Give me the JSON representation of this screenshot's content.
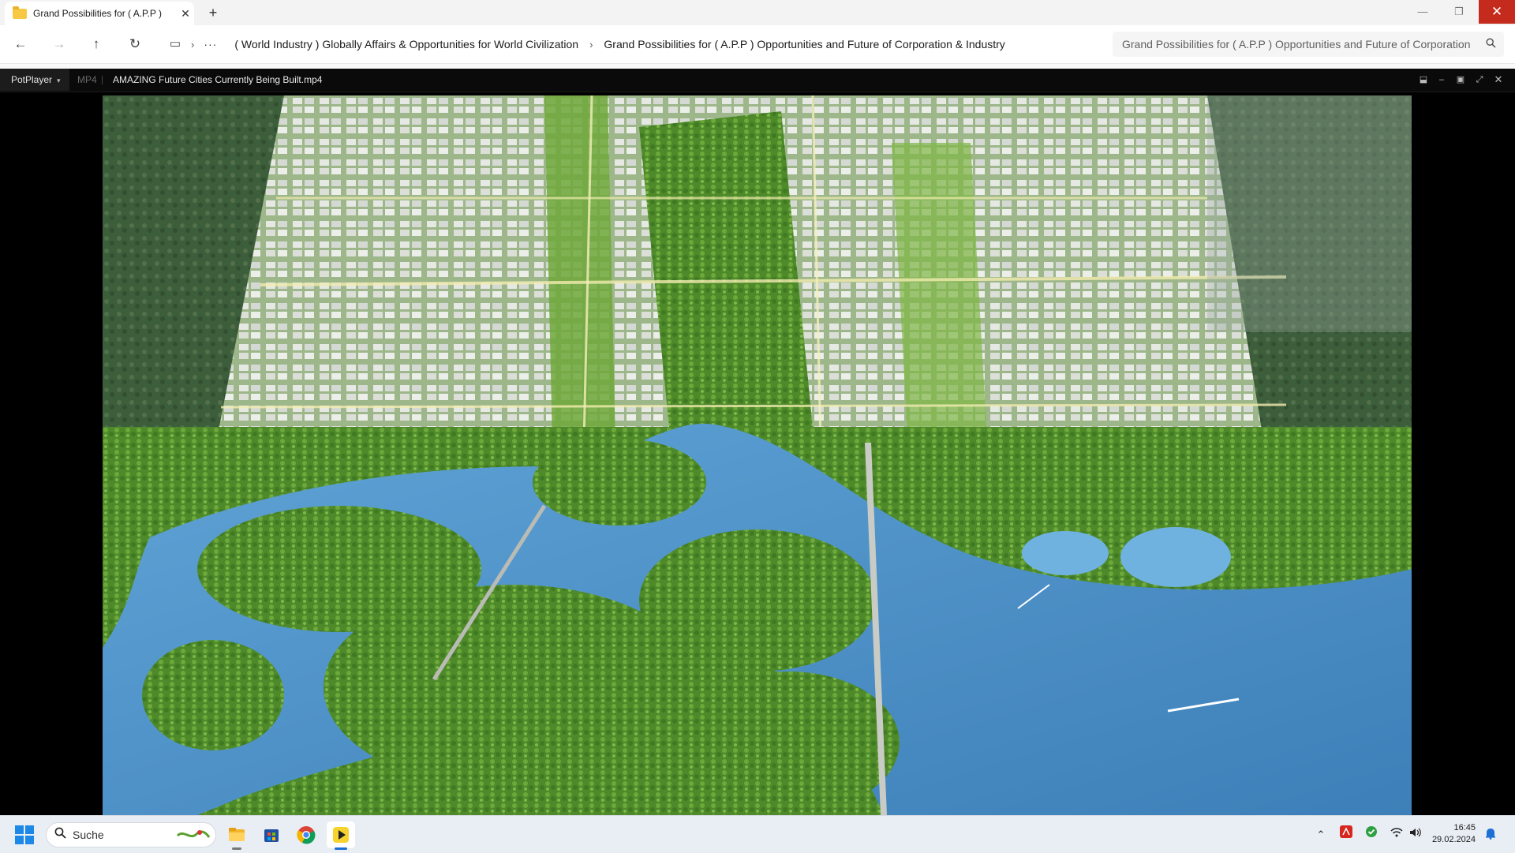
{
  "explorer": {
    "tab_title": "Grand Possibilities for ( A.P.P )",
    "breadcrumb": [
      "( World Industry ) Globally Affairs & Opportunities for World Civilization",
      "Grand Possibilities for ( A.P.P ) Opportunities and Future of Corporation & Industry"
    ],
    "search_placeholder": "Grand Possibilities for ( A.P.P ) Opportunities and Future of Corporation",
    "icons": [
      "folder-icon",
      "close-icon",
      "plus-icon",
      "back-icon",
      "forward-icon",
      "up-icon",
      "refresh-icon",
      "monitor-icon",
      "chevron-right-icon",
      "more-icon",
      "search-icon",
      "minimize-icon",
      "restore-icon"
    ]
  },
  "player": {
    "app_name": "PotPlayer",
    "format": "MP4",
    "filename": "AMAZING Future Cities Currently Being Built.mp4",
    "controls": [
      "pin-icon",
      "minimize-icon",
      "maximize-icon",
      "fullscreen-icon",
      "close-icon"
    ]
  },
  "taskbar": {
    "search_label": "Suche",
    "apps": [
      "file-explorer-icon",
      "microsoft-store-icon",
      "chrome-icon",
      "potplayer-icon"
    ],
    "active_app": "potplayer-icon",
    "tray": [
      "chevron-up-icon",
      "acrobat-icon",
      "security-check-icon",
      "wifi-icon",
      "volume-icon",
      "notification-bell-icon"
    ],
    "time": "16:45",
    "date": "29.02.2024"
  },
  "colors": {
    "close_red": "#c42b1c",
    "accent_blue": "#1d6fd6",
    "water": "#5a9bcf",
    "forest": "#4c8a2c"
  }
}
